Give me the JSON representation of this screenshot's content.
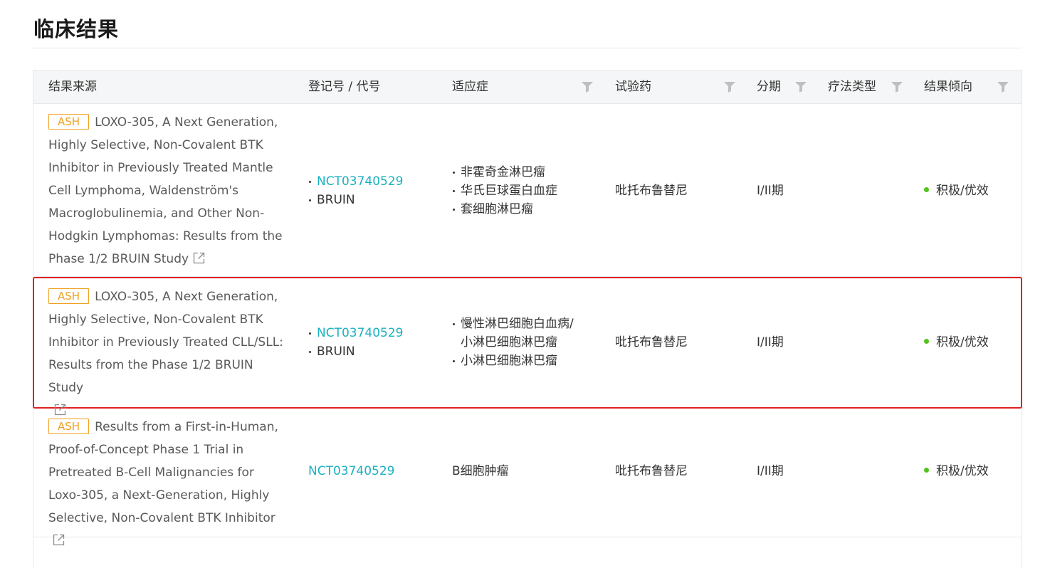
{
  "page": {
    "title": "临床结果"
  },
  "table": {
    "headers": {
      "source": "结果来源",
      "registry": "登记号 / 代号",
      "indication": "适应症",
      "drug": "试验药",
      "phase": "分期",
      "therapy": "疗法类型",
      "outcome": "结果倾向"
    },
    "filter_icon": "filter-icon",
    "rows": [
      {
        "tag": "ASH",
        "title": "LOXO-305, A Next Generation, Highly Selective, Non-Covalent BTK Inhibitor in Previously Treated Mantle Cell Lymphoma, Waldenström's Macroglobulinemia, and Other Non-Hodgkin Lymphomas: Results from the Phase 1/2 BRUIN Study",
        "registry": [
          "NCT03740529",
          "BRUIN"
        ],
        "indications": [
          "非霍奇金淋巴瘤",
          "华氏巨球蛋白血症",
          "套细胞淋巴瘤"
        ],
        "drug": "吡托布鲁替尼",
        "phase": "I/II期",
        "therapy": "",
        "outcome": "积极/优效"
      },
      {
        "tag": "ASH",
        "title": "LOXO-305, A Next Generation, Highly Selective, Non-Covalent BTK Inhibitor in Previously Treated CLL/SLL: Results from the Phase 1/2 BRUIN Study",
        "registry": [
          "NCT03740529",
          "BRUIN"
        ],
        "indications": [
          "慢性淋巴细胞白血病/小淋巴细胞淋巴瘤",
          "小淋巴细胞淋巴瘤"
        ],
        "indication_lines": [
          "慢性淋巴细胞白血病/",
          "小淋巴细胞淋巴瘤"
        ],
        "drug": "吡托布鲁替尼",
        "phase": "I/II期",
        "therapy": "",
        "outcome": "积极/优效"
      },
      {
        "tag": "ASH",
        "title": "Results from a First-in-Human, Proof-of-Concept Phase 1 Trial in Pretreated B-Cell Malignancies for Loxo-305, a Next-Generation, Highly Selective, Non-Covalent BTK Inhibitor",
        "registry": [
          "NCT03740529"
        ],
        "indications": [
          "B细胞肿瘤"
        ],
        "drug": "吡托布鲁替尼",
        "phase": "I/II期",
        "therapy": "",
        "outcome": "积极/优效"
      }
    ]
  },
  "colors": {
    "link": "#1bb1c0",
    "tag": "#f0a020",
    "positive_dot": "#52c41a",
    "highlight_border": "#e02020"
  }
}
